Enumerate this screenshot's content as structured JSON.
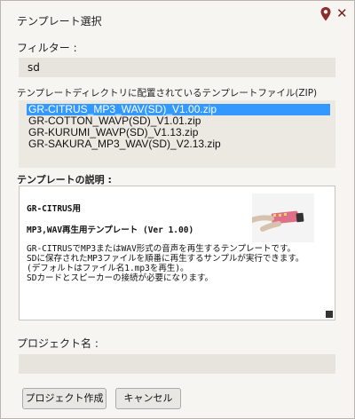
{
  "dialog": {
    "title": "テンプレート選択",
    "filter_label": "フィルター :",
    "filter_value": "sd",
    "list_label": "テンプレートディレクトリに配置されているテンプレートファイル(ZIP)",
    "templates": [
      "GR-CITRUS_MP3_WAV(SD)_V1.00.zip",
      "GR-COTTON_WAVP(SD)_V1.01.zip",
      "GR-KURUMI_WAVP(SD)_V1.13.zip",
      "GR-SAKURA_MP3_WAV(SD)_V2.13.zip"
    ],
    "selected_index": 0,
    "description_label": "テンプレートの説明 :",
    "description": {
      "heading1": "GR-CITRUS用",
      "heading2": "MP3,WAV再生用テンプレート (Ver 1.00)",
      "lines": [
        "GR-CITRUSでMP3またはWAV形式の音声を再生するテンプレートです。",
        "SDに保存されたMP3ファイルを順番に再生するサンプルが実行できます。",
        "(デフォルトはファイル名1.mp3を再生)。",
        "SDカードとスピーカーの接続が必要になります。"
      ]
    },
    "project_label": "プロジェクト名 :",
    "project_value": "",
    "create_button": "プロジェクト作成",
    "cancel_button": "キャンセル"
  },
  "colors": {
    "selection": "#3399ff",
    "close": "#7a2020",
    "pin": "#8b2e2e",
    "board": "#e0708a"
  },
  "icons": {
    "pin": "map-pin-icon",
    "close": "close-icon"
  }
}
